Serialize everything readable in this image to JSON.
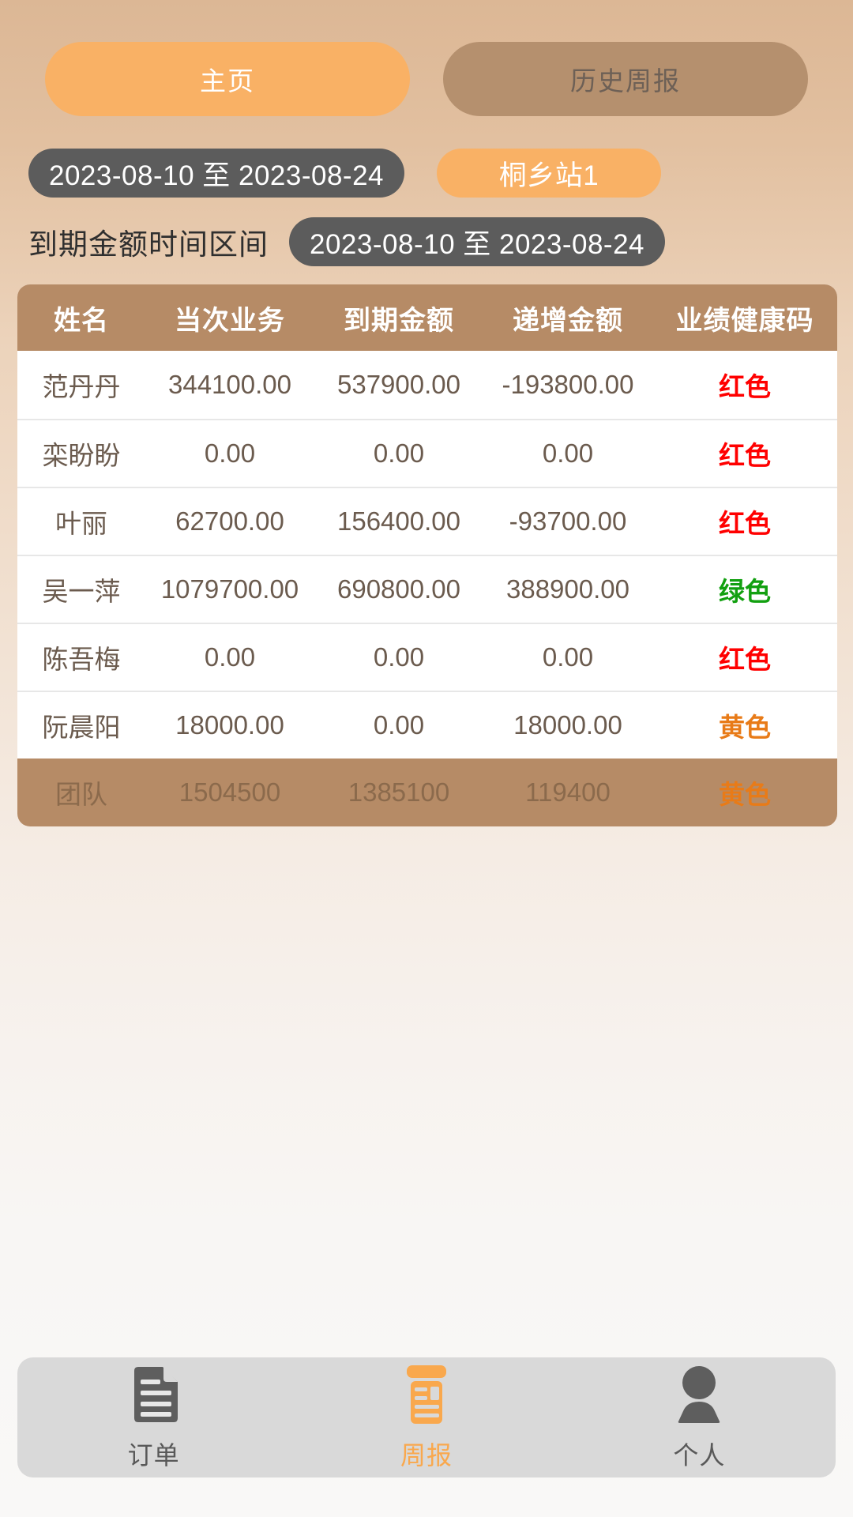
{
  "top_tabs": [
    {
      "label": "主页",
      "active": true
    },
    {
      "label": "历史周报",
      "active": false
    }
  ],
  "filters": {
    "date_range": "2023-08-10 至 2023-08-24",
    "station": "桐乡站1",
    "due_label": "到期金额时间区间",
    "due_date_range": "2023-08-10 至 2023-08-24"
  },
  "table": {
    "headers": [
      "姓名",
      "当次业务",
      "到期金额",
      "递增金额",
      "业绩健康码"
    ],
    "rows": [
      {
        "name": "范丹丹",
        "current": "344100.00",
        "due": "537900.00",
        "increment": "-193800.00",
        "code": "红色",
        "code_color": "red"
      },
      {
        "name": "栾盼盼",
        "current": "0.00",
        "due": "0.00",
        "increment": "0.00",
        "code": "红色",
        "code_color": "red"
      },
      {
        "name": "叶丽",
        "current": "62700.00",
        "due": "156400.00",
        "increment": "-93700.00",
        "code": "红色",
        "code_color": "red"
      },
      {
        "name": "吴一萍",
        "current": "1079700.00",
        "due": "690800.00",
        "increment": "388900.00",
        "code": "绿色",
        "code_color": "green"
      },
      {
        "name": "陈吾梅",
        "current": "0.00",
        "due": "0.00",
        "increment": "0.00",
        "code": "红色",
        "code_color": "red"
      },
      {
        "name": "阮晨阳",
        "current": "18000.00",
        "due": "0.00",
        "increment": "18000.00",
        "code": "黄色",
        "code_color": "yellow"
      }
    ],
    "total": {
      "name": "团队",
      "current": "1504500",
      "due": "1385100",
      "increment": "119400",
      "code": "黄色",
      "code_color": "yellow"
    }
  },
  "bottom_nav": [
    {
      "label": "订单",
      "icon": "document-icon",
      "active": false
    },
    {
      "label": "周报",
      "icon": "report-icon",
      "active": true
    },
    {
      "label": "个人",
      "icon": "person-icon",
      "active": false
    }
  ],
  "colors": {
    "accent_orange": "#f9b165",
    "header_brown": "#b68b66",
    "inactive_brown": "#b5906e",
    "chip_dark": "#5c5c5c",
    "code_red": "#ff0000",
    "code_green": "#12a010",
    "code_yellow": "#e87b18"
  }
}
